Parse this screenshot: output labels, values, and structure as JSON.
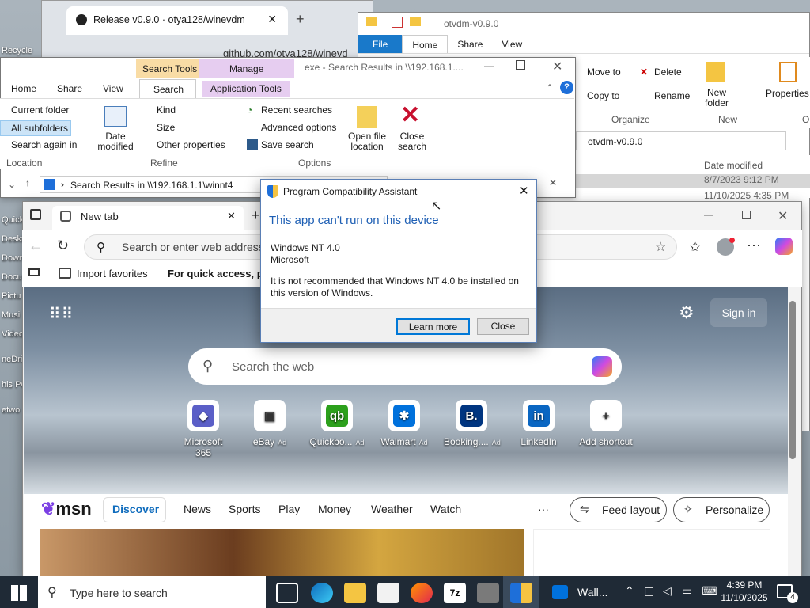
{
  "desktop": {
    "icons": [
      "Recycle",
      "Quick a",
      "Deskt",
      "Down",
      "Docu",
      "Pictu",
      "Musi",
      "Video",
      "neDri",
      "his PC",
      "etwo"
    ]
  },
  "github_tab": {
    "title": "Release v0.9.0 · otya128/winevdm",
    "url": "github.com/otya128/winevd"
  },
  "explorer_back": {
    "title": "otvdm-v0.9.0",
    "tabs": [
      "File",
      "Home",
      "Share",
      "View"
    ],
    "ribbon": {
      "move_to": "Move to",
      "copy_to": "Copy to",
      "delete": "Delete",
      "rename": "Rename",
      "new_folder": "New folder",
      "properties": "Properties",
      "organize": "Organize",
      "new": "New",
      "open": "O"
    },
    "address": "otvdm-v0.9.0",
    "column": "Date modified",
    "dates": [
      "8/7/2023 9:12 PM",
      "11/10/2025 4:35 PM"
    ]
  },
  "explorer": {
    "context_tabs": {
      "search_tools": "Search Tools",
      "manage": "Manage"
    },
    "title": "exe - Search Results in \\\\192.168.1....",
    "tabs": [
      "Home",
      "Share",
      "View",
      "Search",
      "Application Tools"
    ],
    "location": {
      "current_folder": "Current folder",
      "all_subfolders": "All subfolders",
      "search_again": "Search again in",
      "label": "Location"
    },
    "refine": {
      "date_modified": "Date modified",
      "kind": "Kind",
      "size": "Size",
      "other_properties": "Other properties",
      "label": "Refine"
    },
    "options": {
      "recent_searches": "Recent searches",
      "advanced_options": "Advanced options",
      "save_search": "Save search",
      "open_file_location": "Open file location",
      "close_search": "Close search",
      "label": "Options"
    },
    "address": "Search Results in \\\\192.168.1.1\\winnt4"
  },
  "edge": {
    "tab_title": "New tab",
    "address_placeholder": "Search or enter web address",
    "favorites": {
      "import": "Import favorites",
      "quick_access": "For quick access, plac"
    },
    "sign_in": "Sign in",
    "search_placeholder": "Search the web",
    "shortcuts": [
      {
        "label": "Microsoft 365",
        "ad": "",
        "color": "#5b5fc7",
        "glyph": "◆"
      },
      {
        "label": "eBay",
        "ad": "Ad",
        "color": "#ffffff",
        "glyph": "▣"
      },
      {
        "label": "Quickbo...",
        "ad": "Ad",
        "color": "#2ca01c",
        "glyph": "qb"
      },
      {
        "label": "Walmart",
        "ad": "Ad",
        "color": "#0071dc",
        "glyph": "✱"
      },
      {
        "label": "Booking....",
        "ad": "Ad",
        "color": "#003580",
        "glyph": "B."
      },
      {
        "label": "LinkedIn",
        "ad": "",
        "color": "#0a66c2",
        "glyph": "in"
      },
      {
        "label": "Add shortcut",
        "ad": "",
        "color": "#ffffff",
        "glyph": "+"
      }
    ],
    "msn": {
      "logo": "msn",
      "nav": [
        "Discover",
        "News",
        "Sports",
        "Play",
        "Money",
        "Weather",
        "Watch"
      ],
      "more": "···",
      "feed_layout": "Feed layout",
      "personalize": "Personalize"
    }
  },
  "dialog": {
    "title": "Program Compatibility Assistant",
    "heading": "This app can't run on this device",
    "app_name": "Windows NT 4.0",
    "publisher": "Microsoft",
    "message": "It is not recommended that Windows NT 4.0 be installed on this version of Windows.",
    "learn_more": "Learn more",
    "close": "Close"
  },
  "taskbar": {
    "search": "Type here to search",
    "walmart": "Wall...",
    "time": "4:39 PM",
    "date": "11/10/2025",
    "notifications": "4"
  }
}
